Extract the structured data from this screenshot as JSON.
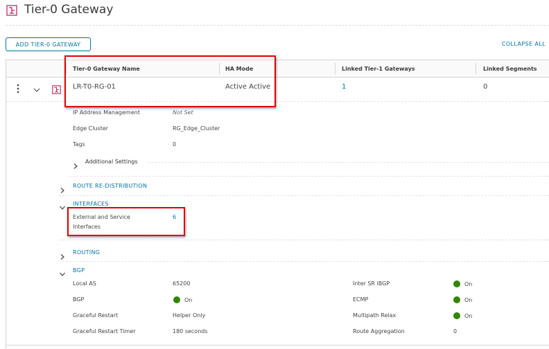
{
  "page": {
    "title": "Tier-0 Gateway"
  },
  "toolbar": {
    "add_label": "ADD TIER-0 GATEWAY",
    "collapse_label": "COLLAPSE ALL"
  },
  "table": {
    "headers": [
      "Tier-0 Gateway Name",
      "HA Mode",
      "Linked Tier-1 Gateways",
      "Linked Segments"
    ],
    "row": {
      "name": "LR-T0-RG-01",
      "ha_mode": "Active Active",
      "linked_t1": "1",
      "linked_segments": "0"
    }
  },
  "details": {
    "ipam_label": "IP Address Management",
    "ipam_value": "Not Set",
    "edge_label": "Edge Cluster",
    "edge_value": "RG_Edge_Cluster",
    "tags_label": "Tags",
    "tags_value": "0",
    "additional_settings": "Additional Settings"
  },
  "sections": {
    "route_redistribution": "ROUTE RE-DISTRIBUTION",
    "interfaces": "INTERFACES",
    "routing": "ROUTING",
    "bgp": "BGP"
  },
  "interfaces": {
    "label_line1": "External and Service",
    "label_line2": "Interfaces",
    "value": "6"
  },
  "bgp": {
    "local_as_label": "Local AS",
    "local_as_value": "65200",
    "bgp_label": "BGP",
    "bgp_value": "On",
    "graceful_restart_label": "Graceful Restart",
    "graceful_restart_value": "Helper Only",
    "gr_timer_label": "Graceful Restart Timer",
    "gr_timer_value": "180 seconds",
    "inter_sr_label": "Inter SR iBGP",
    "inter_sr_value": "On",
    "ecmp_label": "ECMP",
    "ecmp_value": "On",
    "multipath_label": "Multipath Relax",
    "multipath_value": "On",
    "route_agg_label": "Route Aggregation",
    "route_agg_value": "0"
  },
  "colors": {
    "accent": "#0072a3",
    "status_on": "#318700",
    "highlight": "#e00000",
    "icon": "#c2185b"
  },
  "icons": {
    "gateway": "gateway-icon",
    "menu": "kebab-menu-icon",
    "expand": "chevron-icon",
    "status": "status-dot-icon"
  }
}
